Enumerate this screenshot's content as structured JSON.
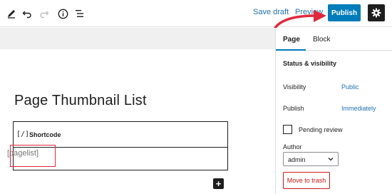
{
  "toolbar": {
    "save_draft": "Save draft",
    "preview": "Preview",
    "publish": "Publish"
  },
  "editor": {
    "title": "Page Thumbnail List",
    "shortcode_icon": "[/]",
    "shortcode_label": "Shortcode",
    "shortcode_value": "[pagelist]"
  },
  "sidebar": {
    "tabs": [
      "Page",
      "Block"
    ],
    "section_title": "Status & visibility",
    "visibility_label": "Visibility",
    "visibility_value": "Public",
    "publish_label": "Publish",
    "publish_value": "Immediately",
    "pending_review": "Pending review",
    "author_label": "Author",
    "author_value": "admin",
    "trash": "Move to trash"
  },
  "colors": {
    "accent": "#007cba",
    "link": "#2271b1",
    "annotation": "#e2283c",
    "danger": "#cc1818"
  },
  "icons": [
    "pencil-icon",
    "undo-icon",
    "redo-icon",
    "info-icon",
    "list-view-icon",
    "gear-icon",
    "plus-icon",
    "chevron-down-icon"
  ]
}
